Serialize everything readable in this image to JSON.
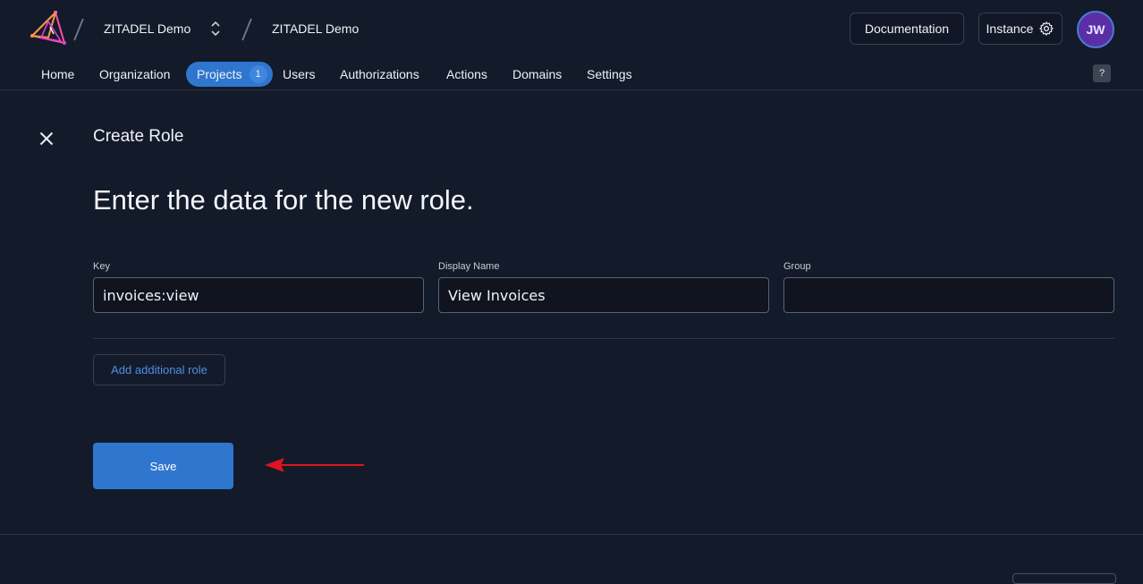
{
  "header": {
    "org_name": "ZITADEL Demo",
    "project_name": "ZITADEL Demo",
    "documentation_label": "Documentation",
    "instance_label": "Instance",
    "avatar_initials": "JW",
    "help_label": "?"
  },
  "nav": {
    "items": [
      {
        "label": "Home"
      },
      {
        "label": "Organization"
      },
      {
        "label": "Projects",
        "badge": "1",
        "active": true
      },
      {
        "label": "Users"
      },
      {
        "label": "Authorizations"
      },
      {
        "label": "Actions"
      },
      {
        "label": "Domains"
      },
      {
        "label": "Settings"
      }
    ]
  },
  "page": {
    "title": "Create Role",
    "subtitle": "Enter the data for the new role."
  },
  "form": {
    "key_label": "Key",
    "key_value": "invoices:view",
    "display_name_label": "Display Name",
    "display_name_value": "View Invoices",
    "group_label": "Group",
    "group_value": "",
    "add_role_label": "Add additional role",
    "save_label": "Save"
  },
  "colors": {
    "background": "#131a2a",
    "accent": "#2f76cf",
    "annotation_arrow": "#e0141c"
  }
}
